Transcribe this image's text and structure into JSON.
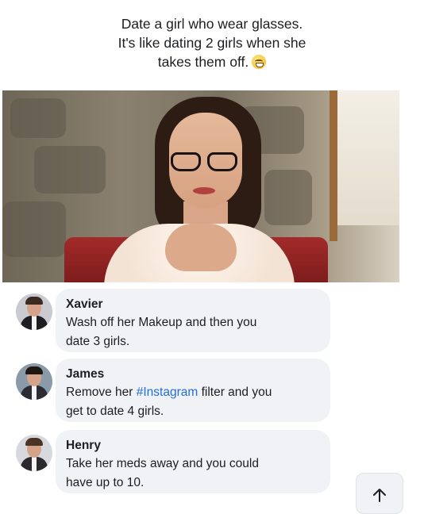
{
  "post": {
    "caption_line1": "Date a girl who wear glasses.",
    "caption_line2": "It's like dating 2 girls when she",
    "caption_line3": "takes them off.",
    "emoji": "grinning-face-emoji"
  },
  "comments": [
    {
      "name": "Xavier",
      "line1": "Wash off her Makeup and then you",
      "line2": "date 3 girls."
    },
    {
      "name": "James",
      "line1_pre": "Remove her ",
      "hashtag": "#Instagram",
      "line1_post": " filter and you",
      "line2": "get to date 4 girls."
    },
    {
      "name": "Henry",
      "line1": "Take her meds away and you could",
      "line2": "have up to 10."
    }
  ],
  "icons": {
    "scroll_top": "arrow-up-icon"
  }
}
